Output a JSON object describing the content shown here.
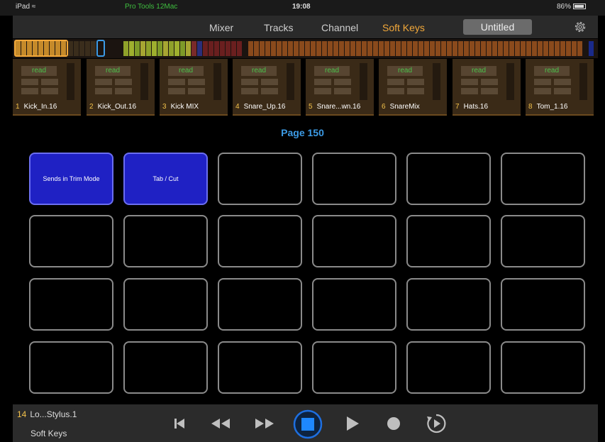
{
  "status_bar": {
    "device": "iPad",
    "app": "Pro Tools 12Mac",
    "time": "19:08",
    "battery": "86%"
  },
  "nav": {
    "items": [
      "Mixer",
      "Tracks",
      "Channel",
      "Soft Keys"
    ],
    "active": "Soft Keys",
    "document_title": "Untitled"
  },
  "channels": [
    {
      "number": "1",
      "name": "Kick_In.16",
      "automation": "read"
    },
    {
      "number": "2",
      "name": "Kick_Out.16",
      "automation": "read"
    },
    {
      "number": "3",
      "name": "Kick MIX",
      "automation": "read"
    },
    {
      "number": "4",
      "name": "Snare_Up.16",
      "automation": "read"
    },
    {
      "number": "5",
      "name": "Snare...wn.16",
      "automation": "read"
    },
    {
      "number": "6",
      "name": "SnareMix",
      "automation": "read"
    },
    {
      "number": "7",
      "name": "Hats.16",
      "automation": "read"
    },
    {
      "number": "8",
      "name": "Tom_1.16",
      "automation": "read"
    }
  ],
  "page_label": "Page 150",
  "soft_keys": [
    "Sends in Trim Mode",
    "Tab / Cut",
    "",
    "",
    "",
    "",
    "",
    "",
    "",
    "",
    "",
    "",
    "",
    "",
    "",
    "",
    "",
    "",
    "",
    "",
    "",
    "",
    "",
    ""
  ],
  "transport": {
    "track_number": "14",
    "track_name": "Lo...Stylus.1",
    "mode": "Soft Keys",
    "buttons": [
      "return-to-zero-icon",
      "rewind-icon",
      "fast-forward-icon",
      "stop-icon",
      "play-icon",
      "record-icon",
      "loop-play-icon"
    ]
  },
  "colors": {
    "accent": "#f2a83a",
    "page_label": "#3c9be6",
    "soft_key_active": "#1f21c4",
    "stop_button": "#1e6fe0",
    "automation_read": "#4cc24c"
  }
}
